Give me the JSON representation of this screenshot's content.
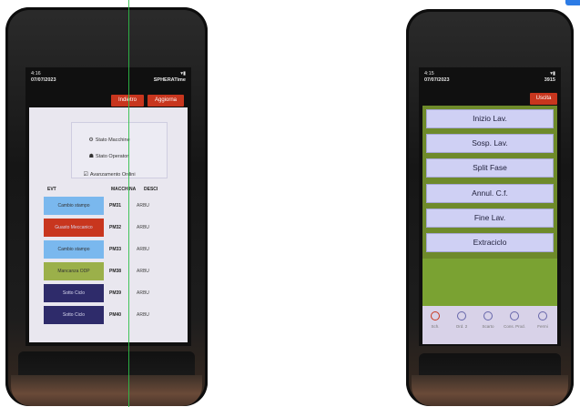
{
  "left_device": {
    "status": {
      "time": "4:16",
      "date": "07/07/2023",
      "app": "SPHERATime"
    },
    "buttons": {
      "back": "Indietro",
      "refresh": "Aggiorna"
    },
    "menu": [
      {
        "icon": "gear-icon",
        "label": "Stato Macchine"
      },
      {
        "icon": "users-icon",
        "label": "Stato Operatori"
      },
      {
        "icon": "checklist-icon",
        "label": "Avanzamento Ordini"
      }
    ],
    "table": {
      "headers": [
        "EVT",
        "MACCHINA",
        "DESCI"
      ],
      "rows": [
        {
          "event": "Cambio stampo",
          "color": "#7ab8ee",
          "machine": "PM31",
          "desc": "ARBU"
        },
        {
          "event": "Guasto Meccanico",
          "color": "#c8361e",
          "machine": "PM32",
          "desc": "ARBU"
        },
        {
          "event": "Cambio stampo",
          "color": "#7ab8ee",
          "machine": "PM33",
          "desc": "ARBU"
        },
        {
          "event": "Mancanza ODP",
          "color": "#9bb04a",
          "machine": "PM38",
          "desc": "ARBU"
        },
        {
          "event": "Sotto Ciclo",
          "color": "#2e2b6a",
          "machine": "PM39",
          "desc": "ARBU"
        },
        {
          "event": "Sotto Ciclo",
          "color": "#2e2b6a",
          "machine": "PM40",
          "desc": "ARBU"
        }
      ]
    }
  },
  "right_device": {
    "status": {
      "time": "4:15",
      "date": "07/07/2023",
      "id": "3915"
    },
    "buttons": {
      "exit": "Uscita"
    },
    "actions": [
      "Inizio Lav.",
      "Sosp. Lav.",
      "Split Fase",
      "Annul. C.f.",
      "Fine Lav.",
      "Extraciclo"
    ],
    "nav": [
      "Sch.",
      "Ord. 2",
      "Scarto",
      "Cons. Prod.",
      "Fermi"
    ]
  }
}
